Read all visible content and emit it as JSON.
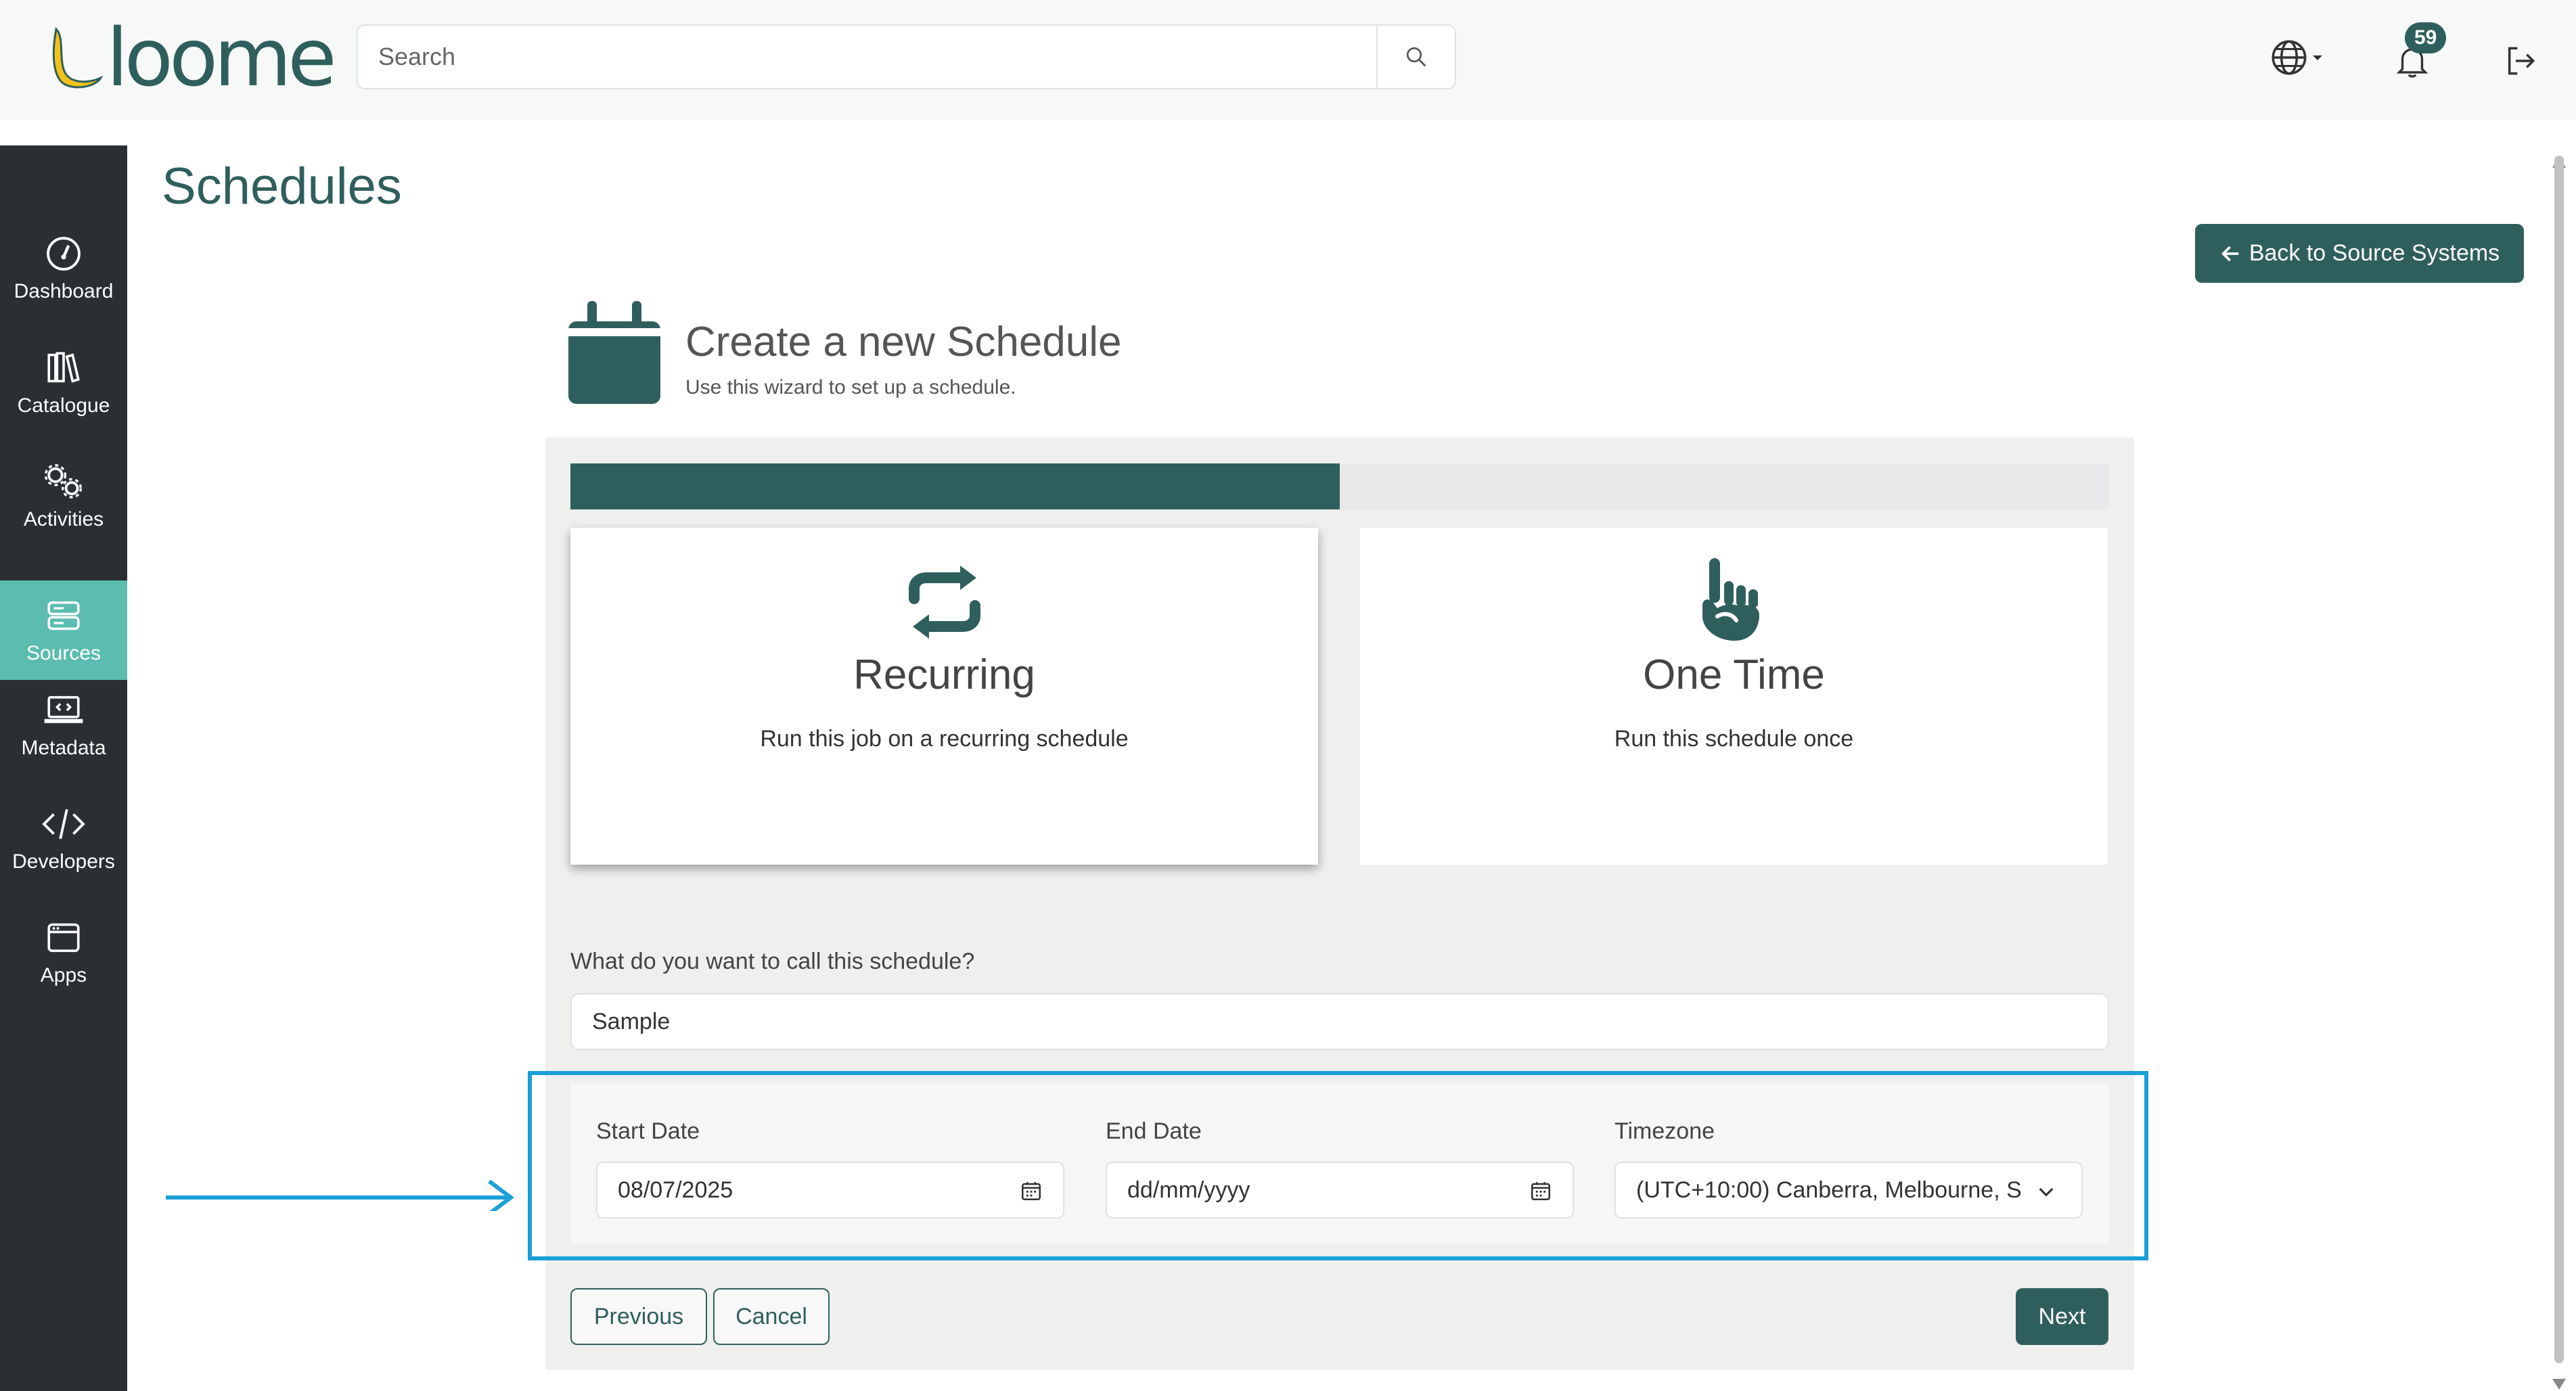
{
  "header": {
    "logo_text": "loome",
    "search_placeholder": "Search",
    "notification_count": "59"
  },
  "sidebar": {
    "items": [
      {
        "label": "Dashboard",
        "icon": "gauge-icon"
      },
      {
        "label": "Catalogue",
        "icon": "books-icon"
      },
      {
        "label": "Activities",
        "icon": "gears-icon"
      },
      {
        "label": "Sources",
        "icon": "server-icon",
        "active": true
      },
      {
        "label": "Metadata",
        "icon": "laptop-code-icon"
      },
      {
        "label": "Developers",
        "icon": "code-icon"
      },
      {
        "label": "Apps",
        "icon": "window-icon"
      }
    ]
  },
  "page": {
    "title": "Schedules",
    "back_button": "Back to Source Systems"
  },
  "wizard": {
    "title": "Create a new Schedule",
    "subtitle": "Use this wizard to set up a schedule.",
    "progress_fraction": 0.5,
    "options": [
      {
        "title": "Recurring",
        "description": "Run this job on a recurring schedule",
        "icon": "repeat-icon",
        "selected": true
      },
      {
        "title": "One Time",
        "description": "Run this schedule once",
        "icon": "pointing-hand-icon",
        "selected": false
      }
    ],
    "name_label": "What do you want to call this schedule?",
    "name_value": "Sample",
    "start_date_label": "Start Date",
    "start_date_value": "08/07/2025",
    "end_date_label": "End Date",
    "end_date_placeholder": "dd/mm/yyyy",
    "timezone_label": "Timezone",
    "timezone_value": "(UTC+10:00) Canberra, Melbourne, S",
    "buttons": {
      "previous": "Previous",
      "cancel": "Cancel",
      "next": "Next"
    }
  },
  "colors": {
    "brand": "#2f5f5d",
    "sidebar_bg": "#2a2f33",
    "sidebar_active": "#5bbcb0",
    "highlight": "#1a9fd9"
  }
}
